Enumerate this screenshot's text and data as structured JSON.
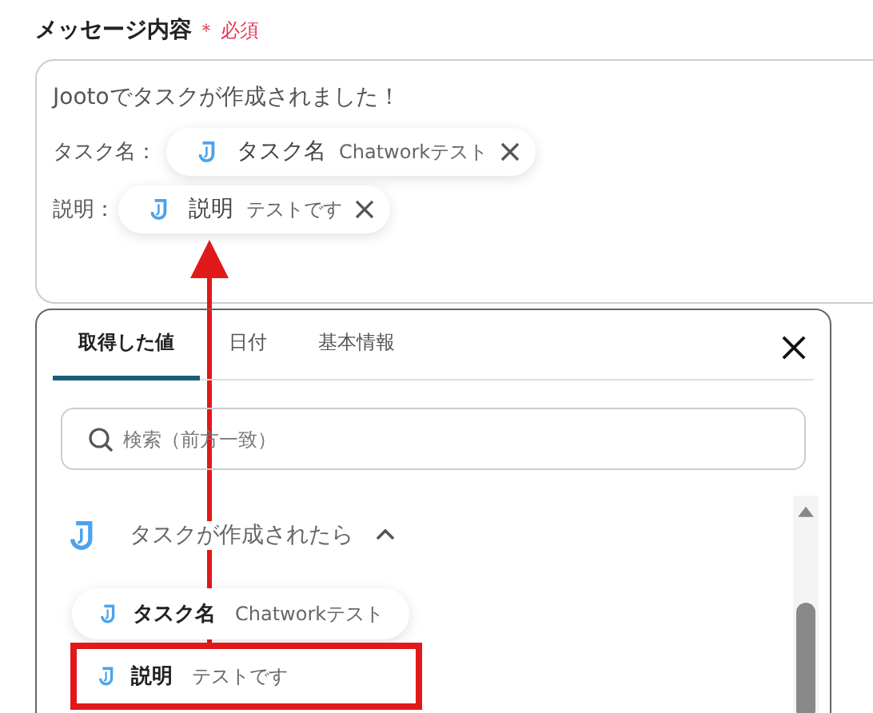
{
  "field": {
    "label": "メッセージ内容",
    "required_mark": "＊",
    "required_text": "必須"
  },
  "message": {
    "first_line": "Jootoでタスクが作成されました！",
    "lines": [
      {
        "label": "タスク名：",
        "chip": {
          "name": "タスク名",
          "value": "Chatworkテスト"
        }
      },
      {
        "label": "説明：",
        "chip": {
          "name": "説明",
          "value": "テストです"
        }
      }
    ]
  },
  "panel": {
    "tabs": [
      {
        "label": "取得した値",
        "selected": true
      },
      {
        "label": "日付",
        "selected": false
      },
      {
        "label": "基本情報",
        "selected": false
      }
    ],
    "search": {
      "placeholder": "検索（前方一致）"
    },
    "group": {
      "title": "タスクが作成されたら",
      "expanded": true,
      "items": [
        {
          "name": "タスク名",
          "value": "Chatworkテスト",
          "highlighted": false
        },
        {
          "name": "説明",
          "value": "テストです",
          "highlighted": true
        }
      ]
    }
  }
}
